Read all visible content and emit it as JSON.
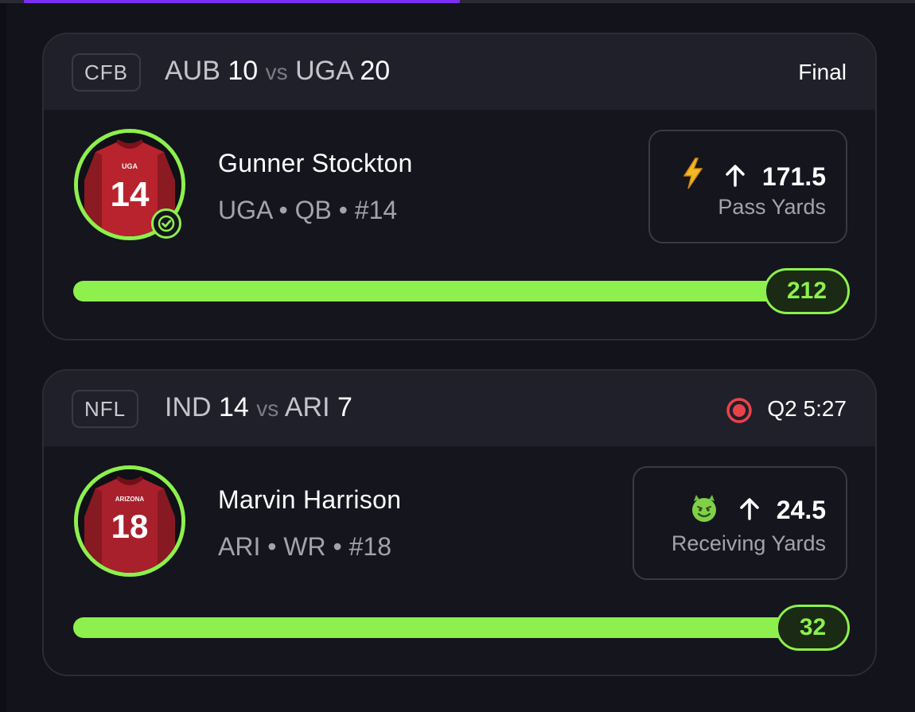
{
  "cards": [
    {
      "league": "CFB",
      "away_team": "AUB",
      "away_score": "10",
      "vs": "vs",
      "home_team": "UGA",
      "home_score": "20",
      "status": "Final",
      "jersey_text": "UGA",
      "jersey_number": "14",
      "player_name": "Gunner Stockton",
      "player_meta": "UGA • QB • #14",
      "tag_icon": "lightning-bolt-icon",
      "direction": "up",
      "line": "171.5",
      "stat_label": "Pass Yards",
      "actual": "212",
      "progress_pct": 100,
      "result_checked": true
    },
    {
      "league": "NFL",
      "away_team": "IND",
      "away_score": "14",
      "vs": "vs",
      "home_team": "ARI",
      "home_score": "7",
      "status": "Q2 5:27",
      "live": true,
      "jersey_text": "ARIZONA",
      "jersey_number": "18",
      "player_name": "Marvin Harrison",
      "player_meta": "ARI • WR • #18",
      "tag_icon": "devil-face-icon",
      "direction": "up",
      "line": "24.5",
      "stat_label": "Receiving Yards",
      "actual": "32",
      "progress_pct": 100
    }
  ],
  "colors": {
    "accent_green": "#8df04d",
    "live_red": "#e8434a",
    "lightning_gold": "#f3b825",
    "background": "#13131b",
    "card": "#15151d",
    "card_header": "#20202a",
    "tab_accent": "#7a2ff0"
  }
}
